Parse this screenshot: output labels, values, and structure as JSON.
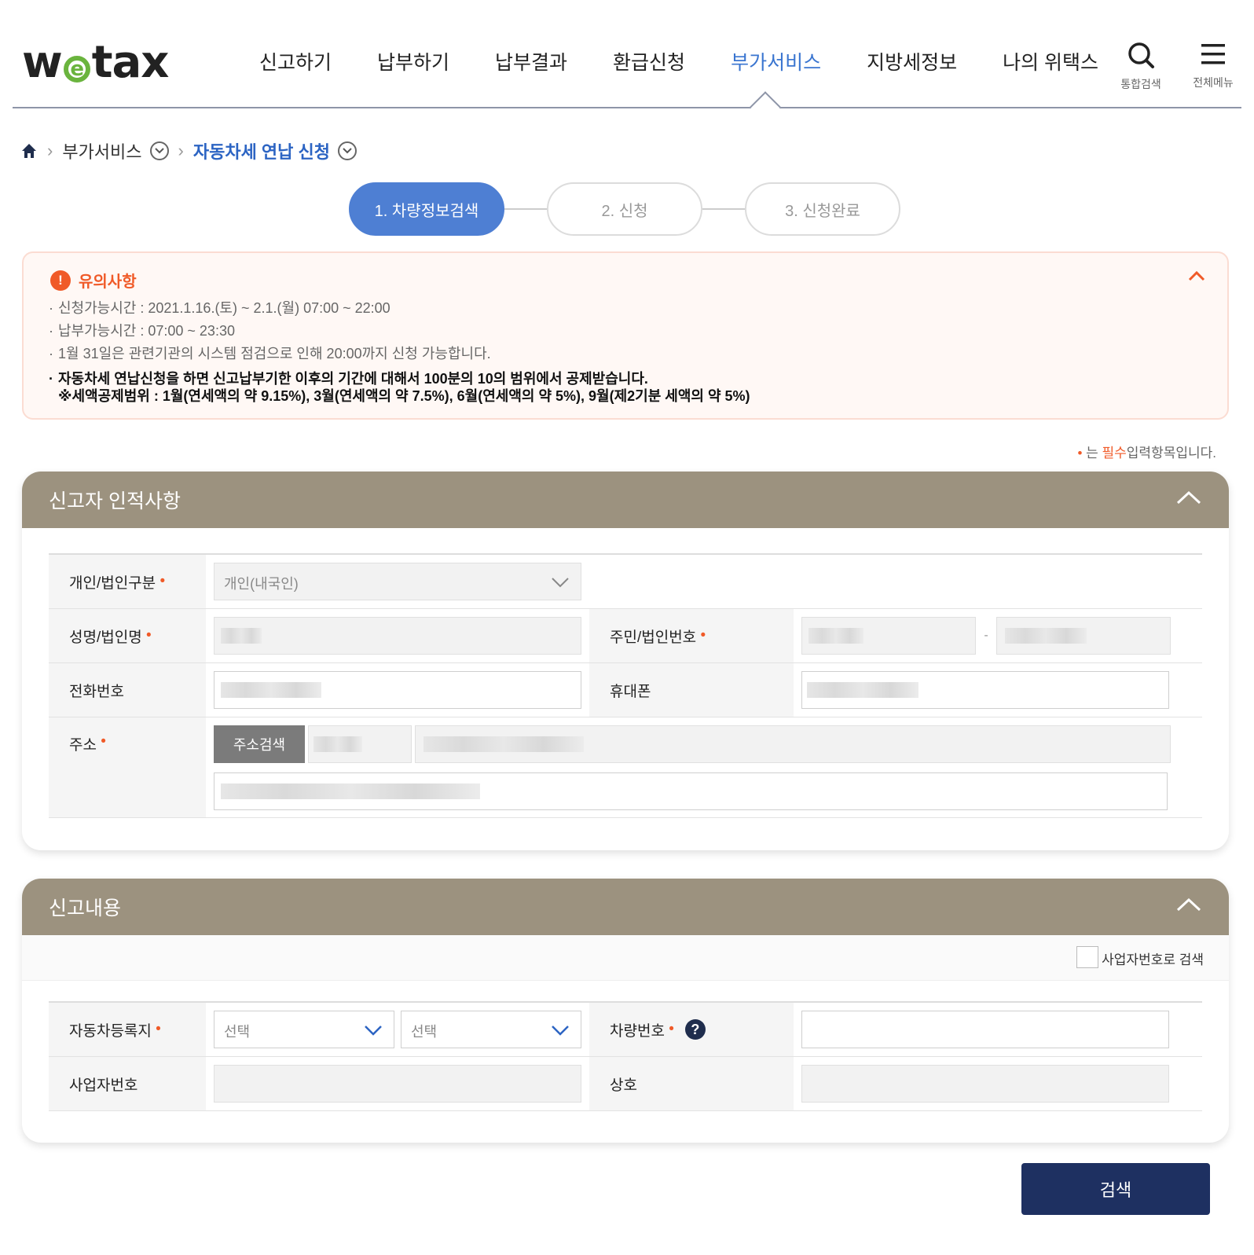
{
  "header": {
    "logo_text_left": "w",
    "logo_text_e": "e",
    "logo_text_right": "tax",
    "nav": [
      "신고하기",
      "납부하기",
      "납부결과",
      "환급신청",
      "부가서비스",
      "지방세정보",
      "나의 위택스"
    ],
    "active_nav": "부가서비스",
    "search_label": "통합검색",
    "menu_label": "전체메뉴"
  },
  "breadcrumb": {
    "home_icon": "home-icon",
    "level1": "부가서비스",
    "level2": "자동차세 연납 신청"
  },
  "steps": [
    "1. 차량정보검색",
    "2. 신청",
    "3. 신청완료"
  ],
  "notice": {
    "title": "유의사항",
    "items": [
      "신청가능시간 : 2021.1.16.(토) ~ 2.1.(월) 07:00 ~ 22:00",
      "납부가능시간 : 07:00 ~ 23:30",
      "1월 31일은 관련기관의 시스템 점검으로 인해 20:00까지 신청 가능합니다."
    ],
    "bold_line1": "자동차세 연납신청을 하면 신고납부기한 이후의 기간에 대해서 100분의 10의 범위에서 공제받습니다.",
    "bold_line2": "※세액공제범위 : 1월(연세액의 약 9.15%), 3월(연세액의 약 7.5%), 6월(연세액의 약 5%), 9월(제2기분 세액의 약 5%)"
  },
  "required_note": {
    "dot": "•",
    "pre": " 는 ",
    "must": "필수",
    "post": "입력항목입니다."
  },
  "panel1": {
    "title": "신고자 인적사항",
    "type_label": "개인/법인구분",
    "type_value": "개인(내국인)",
    "name_label": "성명/법인명",
    "id_label": "주민/법인번호",
    "id_sep": "-",
    "phone_label": "전화번호",
    "mobile_label": "휴대폰",
    "address_label": "주소",
    "address_button": "주소검색"
  },
  "panel2": {
    "title": "신고내용",
    "checkbox_label": "사업자번호로 검색",
    "region_label": "자동차등록지",
    "select1": "선택",
    "select2": "선택",
    "car_number_label": "차량번호",
    "help_symbol": "?",
    "biz_number_label": "사업자번호",
    "company_label": "상호"
  },
  "search_button": "검색",
  "colors": {
    "accent_blue": "#3a75d0",
    "step_active": "#4e7fd3",
    "panel_header": "#9c927f",
    "notice_orange": "#f05a28",
    "search_button": "#1e3061"
  }
}
